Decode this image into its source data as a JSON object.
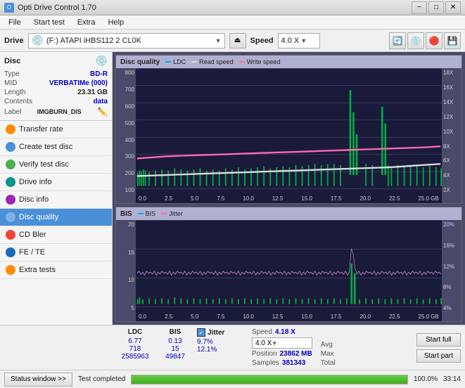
{
  "titlebar": {
    "title": "Opti Drive Control 1.70",
    "min": "−",
    "max": "□",
    "close": "✕"
  },
  "menubar": {
    "items": [
      "File",
      "Start test",
      "Extra",
      "Help"
    ]
  },
  "drivebar": {
    "label": "Drive",
    "drive_text": "(F:)  ATAPI iHBS112  2 CL0K",
    "speed_label": "Speed",
    "speed_value": "4.0 X"
  },
  "disc": {
    "title": "Disc",
    "type_label": "Type",
    "type_value": "BD-R",
    "mid_label": "MID",
    "mid_value": "VERBATIMe (000)",
    "length_label": "Length",
    "length_value": "23.31 GB",
    "contents_label": "Contents",
    "contents_value": "data",
    "label_label": "Label",
    "label_value": "IMGBURN_DIS"
  },
  "nav": {
    "items": [
      {
        "id": "transfer-rate",
        "label": "Transfer rate",
        "color": "orange"
      },
      {
        "id": "create-test-disc",
        "label": "Create test disc",
        "color": "blue"
      },
      {
        "id": "verify-test-disc",
        "label": "Verify test disc",
        "color": "green"
      },
      {
        "id": "drive-info",
        "label": "Drive info",
        "color": "teal"
      },
      {
        "id": "disc-info",
        "label": "Disc info",
        "color": "purple"
      },
      {
        "id": "disc-quality",
        "label": "Disc quality",
        "color": "cyan",
        "active": true
      },
      {
        "id": "cd-bler",
        "label": "CD Bler",
        "color": "red"
      },
      {
        "id": "fe-te",
        "label": "FE / TE",
        "color": "darkblue"
      },
      {
        "id": "extra-tests",
        "label": "Extra tests",
        "color": "orange"
      }
    ]
  },
  "chart1": {
    "title": "Disc quality",
    "legends": [
      "LDC",
      "Read speed",
      "Write speed"
    ],
    "y_left": [
      "800",
      "700",
      "600",
      "500",
      "400",
      "300",
      "200",
      "100"
    ],
    "y_right": [
      "18X",
      "16X",
      "14X",
      "12X",
      "10X",
      "8X",
      "6X",
      "4X",
      "2X"
    ],
    "x_labels": [
      "0.0",
      "2.5",
      "5.0",
      "7.5",
      "10.0",
      "12.5",
      "15.0",
      "17.5",
      "20.0",
      "22.5",
      "25.0 GB"
    ]
  },
  "chart2": {
    "title": "BIS",
    "legends": [
      "BIS",
      "Jitter"
    ],
    "y_left": [
      "20",
      "15",
      "10",
      "5"
    ],
    "y_right": [
      "20%",
      "16%",
      "12%",
      "8%",
      "4%"
    ],
    "x_labels": [
      "0.0",
      "2.5",
      "5.0",
      "7.5",
      "10.0",
      "12.5",
      "15.0",
      "17.5",
      "20.0",
      "22.5",
      "25.0 GB"
    ]
  },
  "stats": {
    "col_headers": [
      "LDC",
      "BIS",
      "",
      "Jitter",
      "Speed"
    ],
    "avg_label": "Avg",
    "avg_ldc": "6.77",
    "avg_bis": "0.13",
    "avg_jitter": "9.7%",
    "avg_speed": "4.18 X",
    "max_label": "Max",
    "max_ldc": "718",
    "max_bis": "15",
    "max_jitter": "12.1%",
    "speed_dropdown": "4.0 X",
    "total_label": "Total",
    "total_ldc": "2585963",
    "total_bis": "49847",
    "position_label": "Position",
    "position_value": "23862 MB",
    "samples_label": "Samples",
    "samples_value": "381343",
    "start_full_label": "Start full",
    "start_part_label": "Start part",
    "jitter_label": "Jitter"
  },
  "bottom": {
    "status_btn": "Status window >>",
    "progress": 100,
    "progress_text": "100.0%",
    "status_text": "Test completed",
    "time": "33:14"
  }
}
